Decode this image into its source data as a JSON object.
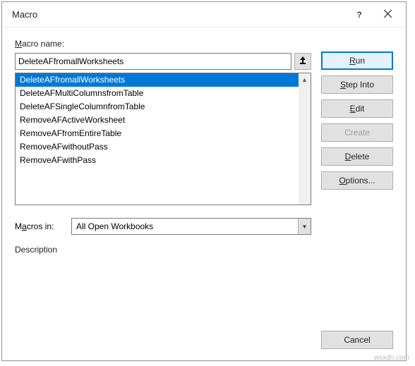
{
  "dialog": {
    "title": "Macro",
    "help_tooltip": "?",
    "close_tooltip": "✕"
  },
  "labels": {
    "macro_name": "Macro name:",
    "macros_in": "Macros in:",
    "description": "Description"
  },
  "macro_name_input": {
    "value": "DeleteAFfromallWorksheets"
  },
  "macro_list": [
    {
      "name": "DeleteAFfromallWorksheets",
      "selected": true
    },
    {
      "name": "DeleteAFMultiColumnsfromTable",
      "selected": false
    },
    {
      "name": "DeleteAFSingleColumnfromTable",
      "selected": false
    },
    {
      "name": "RemoveAFActiveWorksheet",
      "selected": false
    },
    {
      "name": "RemoveAFfromEntireTable",
      "selected": false
    },
    {
      "name": "RemoveAFwithoutPass",
      "selected": false
    },
    {
      "name": "RemoveAFwithPass",
      "selected": false
    }
  ],
  "macros_in_select": {
    "value": "All Open Workbooks"
  },
  "buttons": {
    "run": "Run",
    "step_into": "Step Into",
    "edit": "Edit",
    "create": "Create",
    "delete": "Delete",
    "options": "Options...",
    "cancel": "Cancel"
  },
  "watermark": "wsxdn.com"
}
